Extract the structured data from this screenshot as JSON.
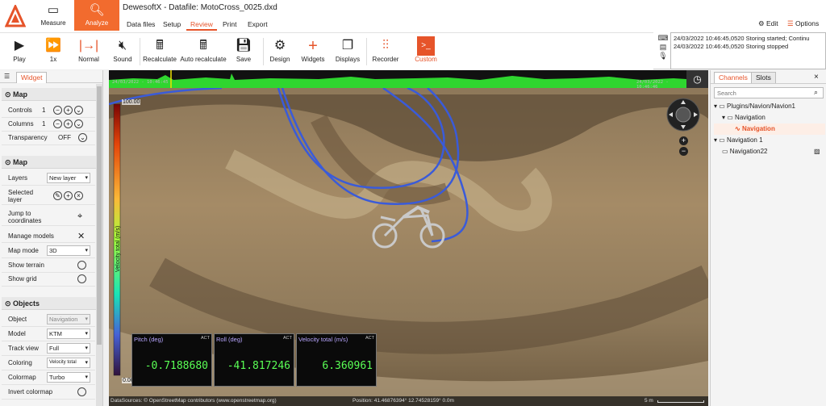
{
  "window": {
    "title": "DewesoftX - Datafile: MotoCross_0025.dxd"
  },
  "modes": {
    "measure": "Measure",
    "analyze": "Analyze"
  },
  "menu": [
    "Data files",
    "Setup",
    "Review",
    "Print",
    "Export"
  ],
  "topright": {
    "edit": "Edit",
    "options": "Options"
  },
  "toolbar": {
    "play": "Play",
    "speed": "1x",
    "normal": "Normal",
    "sound": "Sound",
    "recalculate": "Recalculate",
    "auto_recalculate": "Auto recalculate",
    "save": "Save",
    "design": "Design",
    "widgets": "Widgets",
    "displays": "Displays",
    "recorder": "Recorder",
    "custom": "Custom"
  },
  "log": [
    "24/03/2022 10:46:45,0520 Storing started; Continu",
    "24/03/2022 10:46:45,0520 Storing stopped"
  ],
  "left_panel": {
    "tab": "Widget",
    "sections": {
      "map1": "Map",
      "map2": "Map",
      "objects": "Objects"
    },
    "rows": {
      "controls": {
        "label": "Controls",
        "value": "1"
      },
      "columns": {
        "label": "Columns",
        "value": "1"
      },
      "transparency": {
        "label": "Transparency",
        "value": "OFF"
      },
      "layers": {
        "label": "Layers",
        "value": "New layer"
      },
      "selected_layer": {
        "label": "Selected layer"
      },
      "jump": {
        "label": "Jump to coordinates"
      },
      "manage_models": {
        "label": "Manage models"
      },
      "map_mode": {
        "label": "Map mode",
        "value": "3D"
      },
      "show_terrain": {
        "label": "Show terrain"
      },
      "show_grid": {
        "label": "Show grid"
      },
      "object": {
        "label": "Object",
        "value": "Navigation"
      },
      "model": {
        "label": "Model",
        "value": "KTM"
      },
      "track_view": {
        "label": "Track view",
        "value": "Full"
      },
      "coloring": {
        "label": "Coloring",
        "value": "Velocity total"
      },
      "colormap": {
        "label": "Colormap",
        "value": "Turbo"
      },
      "invert_colormap": {
        "label": "Invert colormap"
      }
    }
  },
  "map": {
    "timeline_start": "24/03/2022 - 10:46:45",
    "timeline_end": "24/03/2022 - 10:46:46",
    "colorbar_max": "100.00",
    "colorbar_min": "0.00",
    "colorbar_label": "Velocity total (m/s)",
    "displays": [
      {
        "title": "Pitch (deg)",
        "act": "ACT",
        "value": "-0.7188680"
      },
      {
        "title": "Roll (deg)",
        "act": "ACT",
        "value": "-41.817246"
      },
      {
        "title": "Velocity total (m/s)",
        "act": "ACT",
        "value": "6.360961"
      }
    ],
    "datasources": "DataSources: © OpenStreetMap contributors (www.openstreetmap.org)",
    "position": "Position: 41.46876394° 12.74528159° 0.0m",
    "scale": "5 m",
    "track_color": "#3a5bd9"
  },
  "right_panel": {
    "tabs": [
      "Channels",
      "Slots"
    ],
    "search_placeholder": "Search",
    "tree": [
      "Plugins/Navion/Navion1",
      "Navigation",
      "Navigation",
      "Navigation 1",
      "Navigation22"
    ]
  },
  "colors": {
    "accent": "#f26b2e",
    "lcd_text": "#5aff55"
  }
}
